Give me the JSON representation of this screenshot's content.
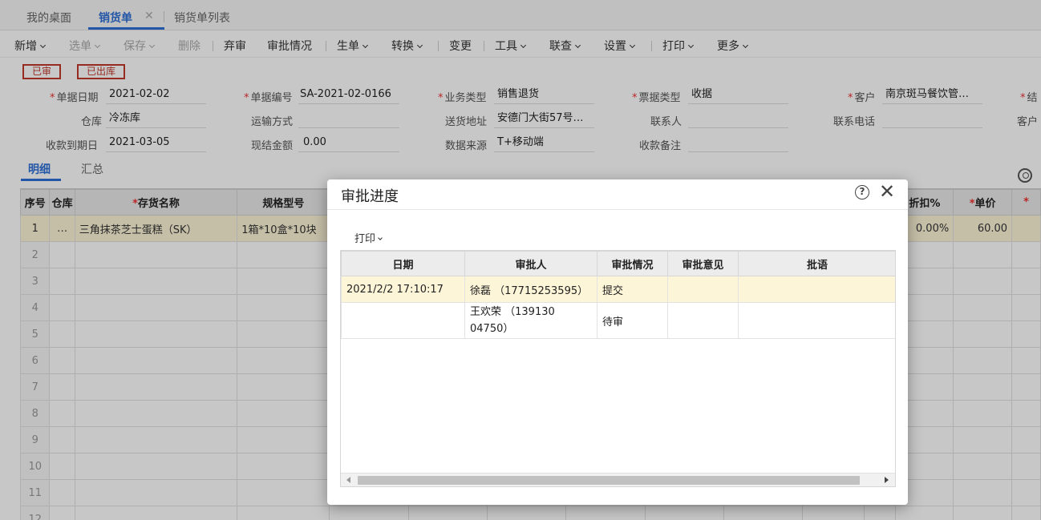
{
  "tabs": [
    {
      "label": "我的桌面"
    },
    {
      "label": "销货单"
    },
    {
      "label": "销货单列表"
    }
  ],
  "toolbar": {
    "items": [
      "新增",
      "选单",
      "保存",
      "删除",
      "弃审",
      "审批情况",
      "生单",
      "转换",
      "变更",
      "工具",
      "联查",
      "设置",
      "打印",
      "更多"
    ]
  },
  "status": {
    "approved": "已审",
    "outbound": "已出库"
  },
  "form": {
    "doc_date_label": "单据日期",
    "doc_date": "2021-02-02",
    "doc_no_label": "单据编号",
    "doc_no": "SA-2021-02-0166",
    "biz_type_label": "业务类型",
    "biz_type": "销售退货",
    "bill_type_label": "票据类型",
    "bill_type": "收据",
    "customer_label": "客户",
    "customer": "南京斑马餐饮管…",
    "settle_label": "结",
    "warehouse_label": "仓库",
    "warehouse": "冷冻库",
    "shipping_label": "运输方式",
    "shipping": "",
    "address_label": "送货地址",
    "address": "安德门大街57号…",
    "contact_label": "联系人",
    "contact": "",
    "phone_label": "联系电话",
    "phone": "",
    "customer_no_label": "客户",
    "due_date_label": "收款到期日",
    "due_date": "2021-03-05",
    "cash_label": "现结金额",
    "cash": "0.00",
    "source_label": "数据来源",
    "source": "T+移动端",
    "remark_label": "收款备注",
    "remark": ""
  },
  "detail_tabs": {
    "detail": "明细",
    "summary": "汇总"
  },
  "grid": {
    "headers": {
      "seq": "序号",
      "warehouse": "仓库",
      "name": "存货名称",
      "spec": "规格型号",
      "discount": "折扣%",
      "price": "单价"
    },
    "rows": [
      {
        "seq": "1",
        "warehouse": "…",
        "name": "三角抹茶芝士蛋糕（SK）",
        "spec": "1箱*10盒*10块",
        "discount": "0.00%",
        "price": "60.00"
      },
      {
        "seq": "2"
      },
      {
        "seq": "3"
      },
      {
        "seq": "4"
      },
      {
        "seq": "5"
      },
      {
        "seq": "6"
      },
      {
        "seq": "7"
      },
      {
        "seq": "8"
      },
      {
        "seq": "9"
      },
      {
        "seq": "10"
      },
      {
        "seq": "11"
      },
      {
        "seq": "12"
      }
    ]
  },
  "dialog": {
    "title": "审批进度",
    "help": "?",
    "close": "✕",
    "print": "打印",
    "headers": {
      "date": "日期",
      "approver": "审批人",
      "status": "审批情况",
      "opinion": "审批意见",
      "comment": "批语"
    },
    "rows": [
      {
        "date": "2021/2/2 17:10:17",
        "approver": "徐磊 （17715253595）",
        "status": "提交",
        "opinion": "",
        "comment": ""
      },
      {
        "date": "",
        "approver": "王欢荣 （13913004750）",
        "status": "待审",
        "opinion": "",
        "comment": ""
      }
    ]
  }
}
